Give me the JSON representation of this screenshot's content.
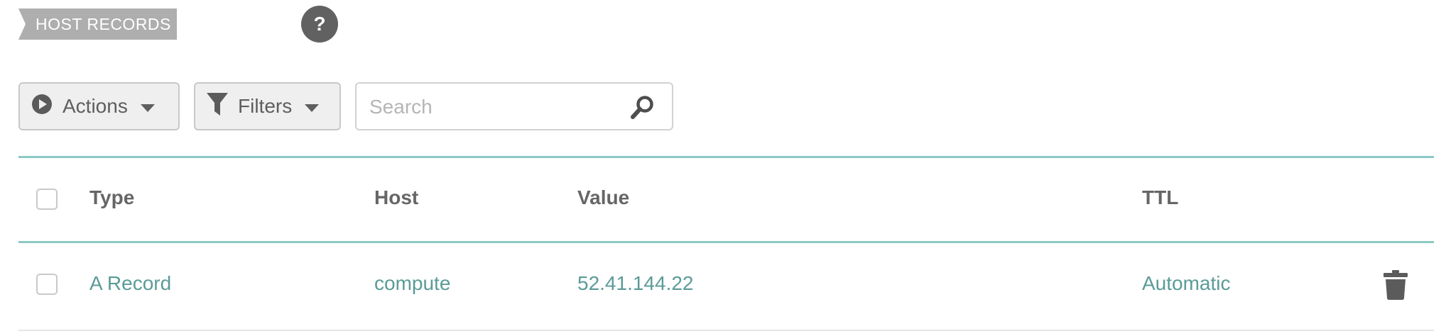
{
  "section": {
    "title": "HOST RECORDS",
    "help_label": "?"
  },
  "toolbar": {
    "actions_label": "Actions",
    "filters_label": "Filters",
    "search_placeholder": "Search"
  },
  "table": {
    "columns": [
      "Type",
      "Host",
      "Value",
      "TTL"
    ],
    "rows": [
      {
        "type": "A Record",
        "host": "compute",
        "value": "52.41.144.22",
        "ttl": "Automatic"
      }
    ]
  },
  "colors": {
    "accent_teal": "#8cc8c4",
    "link_teal": "#5b9b97",
    "tag_grey": "#aeaeae",
    "icon_dark": "#616161"
  },
  "icons": [
    "play-circle-icon",
    "caret-down-icon",
    "funnel-icon",
    "magnifier-icon",
    "trash-icon",
    "help-icon"
  ]
}
